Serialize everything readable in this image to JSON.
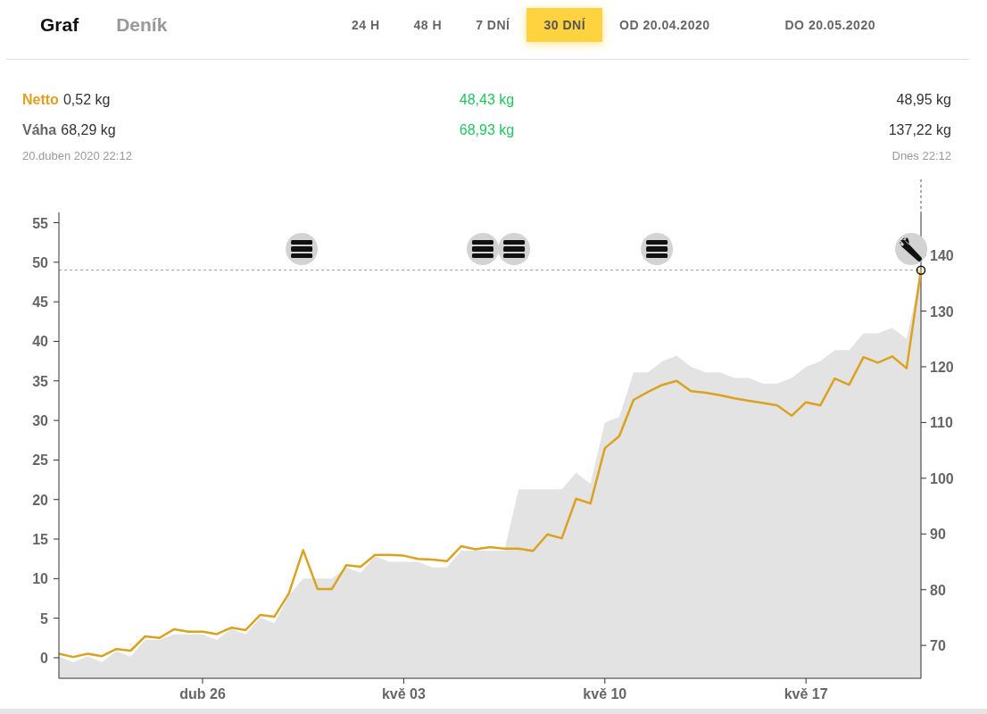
{
  "tabs": [
    {
      "label": "Graf",
      "selected": true
    },
    {
      "label": "Deník",
      "selected": false
    }
  ],
  "ranges": [
    {
      "label": "24 H",
      "selected": false
    },
    {
      "label": "48 H",
      "selected": false
    },
    {
      "label": "7 DNÍ",
      "selected": false
    },
    {
      "label": "30 DNÍ",
      "selected": true
    }
  ],
  "date_from": "OD 20.04.2020",
  "date_to": "DO 20.05.2020",
  "stats": {
    "rows": [
      {
        "label": "Netto",
        "kind": "netto",
        "start": "0,52 kg",
        "change": "48,43 kg",
        "end": "48,95 kg"
      },
      {
        "label": "Váha",
        "kind": "weight",
        "start": "68,29 kg",
        "change": "68,93 kg",
        "end": "137,22 kg"
      }
    ],
    "start_time": "20.duben 2020 22:12",
    "end_time": "Dnes 22:12"
  },
  "weight_chart": {
    "chart_data": {
      "type": "area",
      "series": [
        {
          "color": "#e3e3e3",
          "values": [
            68,
            67,
            68,
            67,
            69,
            68,
            71,
            71,
            72,
            72,
            72,
            71,
            73,
            72,
            75,
            74,
            79,
            82,
            82,
            82,
            84,
            83,
            86,
            85,
            85,
            85,
            84,
            84,
            87,
            87,
            87,
            87,
            98,
            98,
            98,
            98,
            101,
            99,
            110,
            111,
            119,
            119,
            121,
            122,
            120,
            119,
            119,
            118,
            118,
            117,
            117,
            118,
            120,
            121,
            123,
            123,
            126,
            126,
            127,
            125,
            137
          ]
        }
      ],
      "ylim": [
        64.1,
        147.7
      ],
      "yticks": [
        70,
        80,
        90,
        100,
        110,
        120,
        130,
        140
      ]
    }
  },
  "netto_chart": {
    "chart_data": {
      "type": "line",
      "categories": [
        null,
        null,
        null,
        null,
        null,
        null,
        null,
        null,
        null,
        null,
        "dub 26",
        null,
        null,
        null,
        null,
        null,
        null,
        null,
        null,
        null,
        null,
        null,
        null,
        null,
        "kvě 03",
        null,
        null,
        null,
        null,
        null,
        null,
        null,
        null,
        null,
        null,
        null,
        null,
        null,
        "kvě 10",
        null,
        null,
        null,
        null,
        null,
        null,
        null,
        null,
        null,
        null,
        null,
        null,
        null,
        "kvě 17",
        null,
        null,
        null,
        null,
        null,
        null,
        null,
        null
      ],
      "series": [
        {
          "color": "#dba21e",
          "values": [
            0.5,
            0.1,
            0.5,
            0.2,
            1.1,
            0.9,
            2.7,
            2.5,
            3.6,
            3.3,
            3.3,
            3,
            3.8,
            3.5,
            5.4,
            5.2,
            8.1,
            13.6,
            8.7,
            8.7,
            11.7,
            11.5,
            13,
            13,
            12.9,
            12.5,
            12.4,
            12.2,
            14.1,
            13.7,
            14,
            13.8,
            13.8,
            13.5,
            15.6,
            15.1,
            20.1,
            19.5,
            26.5,
            28,
            32.6,
            33.6,
            34.5,
            35,
            33.7,
            33.5,
            33.2,
            32.8,
            32.5,
            32.2,
            31.9,
            30.6,
            32.3,
            31.9,
            35.3,
            34.5,
            38,
            37.3,
            38.1,
            36.6,
            49
          ]
        }
      ],
      "ylim": [
        -2.6,
        56.3
      ],
      "yticks": [
        0,
        5,
        10,
        15,
        20,
        25,
        30,
        35,
        40,
        45,
        50,
        55
      ],
      "ref_lines": [
        {
          "axis": "y",
          "value": 49
        }
      ]
    },
    "markers": [
      {
        "kind": "stack"
      },
      {
        "kind": "stack"
      },
      {
        "kind": "stack"
      },
      {
        "kind": "stack"
      },
      {
        "kind": "service"
      }
    ]
  }
}
